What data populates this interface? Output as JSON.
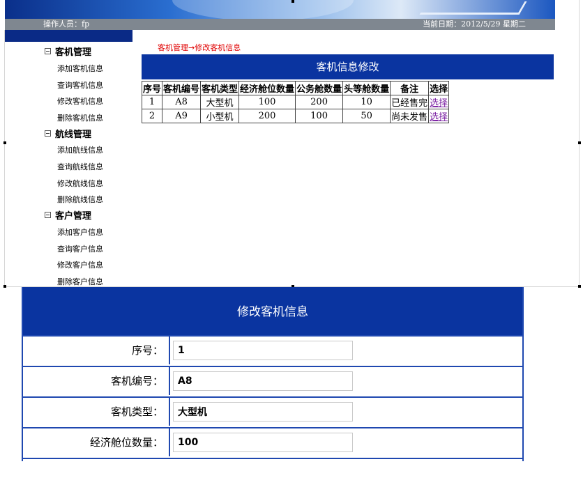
{
  "info_bar": {
    "operator": "操作人员：fp",
    "date": "当前日期：2012/5/29 星期二"
  },
  "sidebar": {
    "groups": [
      {
        "title": "客机管理",
        "items": [
          "添加客机信息",
          "查询客机信息",
          "修改客机信息",
          "删除客机信息"
        ]
      },
      {
        "title": "航线管理",
        "items": [
          "添加航线信息",
          "查询航线信息",
          "修改航线信息",
          "删除航线信息"
        ]
      },
      {
        "title": "客户管理",
        "items": [
          "添加客户信息",
          "查询客户信息",
          "修改客户信息",
          "删除客户信息"
        ]
      }
    ]
  },
  "breadcrumb": "客机管理→修改客机信息",
  "table": {
    "title": "客机信息修改",
    "headers": [
      "序号",
      "客机编号",
      "客机类型",
      "经济舱位数量",
      "公务舱数量",
      "头等舱数量",
      "备注",
      "选择"
    ],
    "rows": [
      [
        "1",
        "A8",
        "大型机",
        "100",
        "200",
        "10",
        "已经售完",
        "选择"
      ],
      [
        "2",
        "A9",
        "小型机",
        "200",
        "100",
        "50",
        "尚未发售",
        "选择"
      ]
    ]
  },
  "form": {
    "title": "修改客机信息",
    "fields": [
      {
        "label": "序号：",
        "value": "1"
      },
      {
        "label": "客机编号：",
        "value": "A8"
      },
      {
        "label": "客机类型：",
        "value": "大型机"
      },
      {
        "label": "经济舱位数量：",
        "value": "100"
      }
    ]
  },
  "colors": {
    "header_blue": "#0a34a0",
    "border_blue": "#1f48b0",
    "breadcrumb_red": "#e00000",
    "info_bar_gray": "#7f8790",
    "link_purple": "#7a1fa2"
  }
}
